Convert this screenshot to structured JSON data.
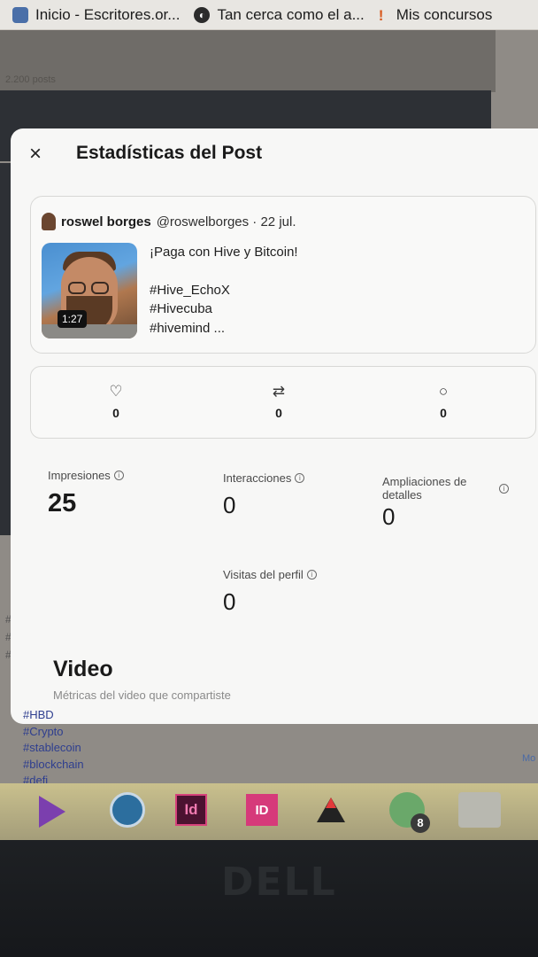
{
  "browser": {
    "tabs": [
      {
        "label": "Inicio - Escritores.or..."
      },
      {
        "label": "Tan cerca como el a..."
      },
      {
        "label": "Mis concursos"
      }
    ]
  },
  "underlay": {
    "posts_count": "2.200 posts"
  },
  "modal": {
    "title": "Estadísticas del Post",
    "close_icon": "×"
  },
  "post": {
    "author_name": "roswel borges",
    "author_meta": "@roswelborges · 22 jul.",
    "video_duration": "1:27",
    "text_line1": "¡Paga con Hive y Bitcoin!",
    "text_line2": "#Hive_EchoX",
    "text_line3": "#Hivecuba",
    "text_line4": "#hivemind ..."
  },
  "engagement": {
    "likes": "0",
    "reposts": "0",
    "replies": "0"
  },
  "metrics": {
    "impressions_label": "Impresiones",
    "impressions_value": "25",
    "interactions_label": "Interacciones",
    "interactions_value": "0",
    "expansions_label_1": "Ampliaciones de",
    "expansions_label_2": "detalles",
    "expansions_value": "0",
    "profile_visits_label": "Visitas del perfil",
    "profile_visits_value": "0"
  },
  "video_section": {
    "title": "Video",
    "subtitle": "Métricas del video que compartiste"
  },
  "underlying_tags": [
    "#HBD",
    "#Crypto",
    "#stablecoin",
    "#blockchain",
    "#defi"
  ],
  "underlying_side_text": "Mo",
  "taskbar": {
    "whatsapp_badge": "8",
    "indesign_label": "Id",
    "id_label": "ID"
  },
  "monitor_brand": "DELL"
}
